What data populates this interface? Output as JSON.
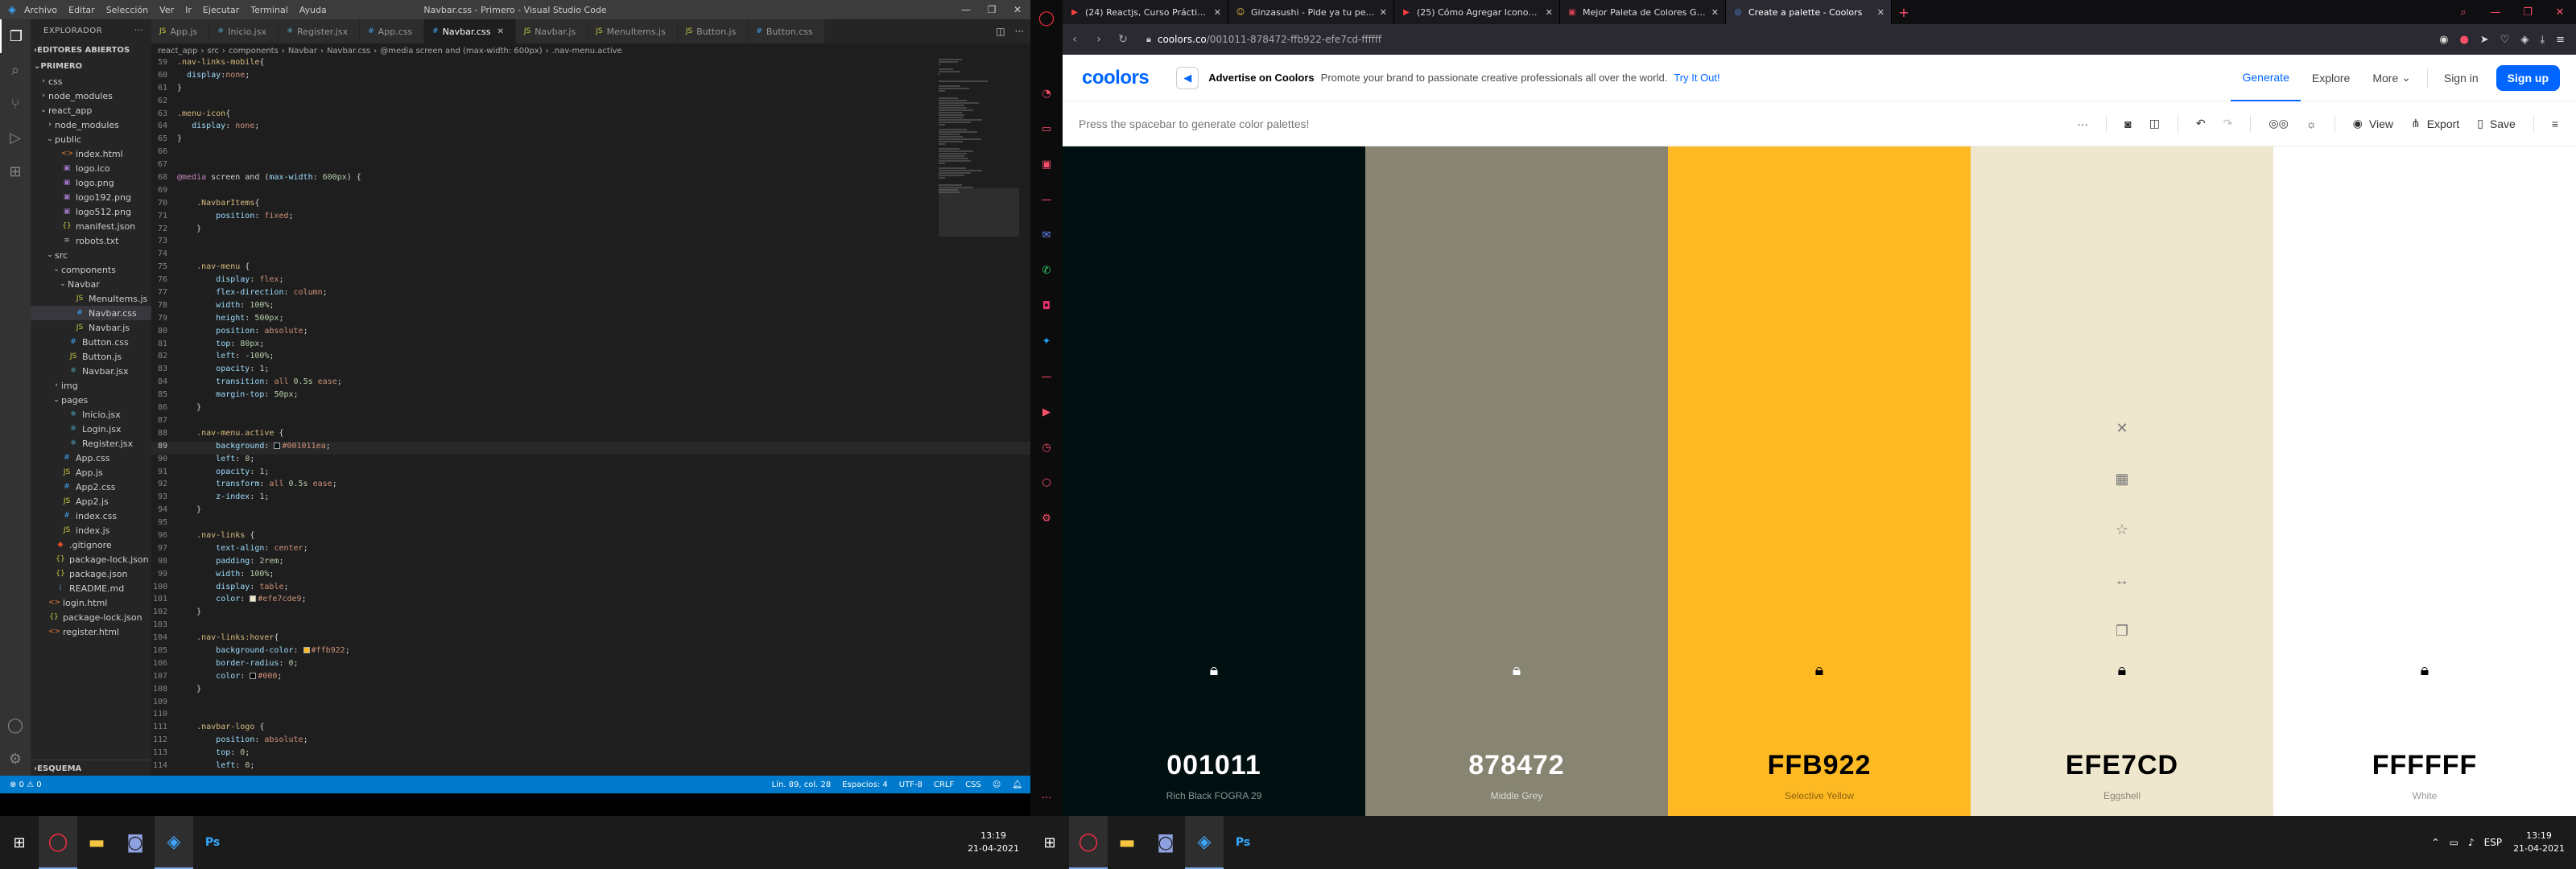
{
  "vscode": {
    "window_title": "Navbar.css - Primero - Visual Studio Code",
    "menu": [
      "Archivo",
      "Editar",
      "Selección",
      "Ver",
      "Ir",
      "Ejecutar",
      "Terminal",
      "Ayuda"
    ],
    "sidebar": {
      "header": "EXPLORADOR",
      "open_editors": "EDITORES ABIERTOS",
      "project": "PRIMERO",
      "outline": "ESQUEMA",
      "tree": [
        {
          "label": "css",
          "type": "folder",
          "depth": 1,
          "open": false
        },
        {
          "label": "node_modules",
          "type": "folder",
          "depth": 1,
          "open": false
        },
        {
          "label": "react_app",
          "type": "folder",
          "depth": 1,
          "open": true
        },
        {
          "label": "node_modules",
          "type": "folder",
          "depth": 2,
          "open": false
        },
        {
          "label": "public",
          "type": "folder",
          "depth": 2,
          "open": true
        },
        {
          "label": "index.html",
          "type": "html",
          "depth": 3
        },
        {
          "label": "logo.ico",
          "type": "img",
          "depth": 3
        },
        {
          "label": "logo.png",
          "type": "img",
          "depth": 3
        },
        {
          "label": "logo192.png",
          "type": "img",
          "depth": 3
        },
        {
          "label": "logo512.png",
          "type": "img",
          "depth": 3
        },
        {
          "label": "manifest.json",
          "type": "json",
          "depth": 3
        },
        {
          "label": "robots.txt",
          "type": "txt",
          "depth": 3
        },
        {
          "label": "src",
          "type": "folder",
          "depth": 2,
          "open": true
        },
        {
          "label": "components",
          "type": "folder",
          "depth": 3,
          "open": true
        },
        {
          "label": "Navbar",
          "type": "folder",
          "depth": 4,
          "open": true
        },
        {
          "label": "MenuItems.js",
          "type": "js",
          "depth": 5
        },
        {
          "label": "Navbar.css",
          "type": "css",
          "depth": 5,
          "selected": true
        },
        {
          "label": "Navbar.js",
          "type": "js",
          "depth": 5
        },
        {
          "label": "Button.css",
          "type": "css",
          "depth": 4
        },
        {
          "label": "Button.js",
          "type": "js",
          "depth": 4
        },
        {
          "label": "Navbar.jsx",
          "type": "jsx",
          "depth": 4
        },
        {
          "label": "img",
          "type": "folder",
          "depth": 3,
          "open": false
        },
        {
          "label": "pages",
          "type": "folder",
          "depth": 3,
          "open": true
        },
        {
          "label": "Inicio.jsx",
          "type": "jsx",
          "depth": 4
        },
        {
          "label": "Login.jsx",
          "type": "jsx",
          "depth": 4
        },
        {
          "label": "Register.jsx",
          "type": "jsx",
          "depth": 4
        },
        {
          "label": "App.css",
          "type": "css",
          "depth": 3
        },
        {
          "label": "App.js",
          "type": "js",
          "depth": 3
        },
        {
          "label": "App2.css",
          "type": "css",
          "depth": 3
        },
        {
          "label": "App2.js",
          "type": "js",
          "depth": 3
        },
        {
          "label": "index.css",
          "type": "css",
          "depth": 3
        },
        {
          "label": "index.js",
          "type": "js",
          "depth": 3
        },
        {
          "label": ".gitignore",
          "type": "git",
          "depth": 2
        },
        {
          "label": "package-lock.json",
          "type": "json",
          "depth": 2
        },
        {
          "label": "package.json",
          "type": "json",
          "depth": 2
        },
        {
          "label": "README.md",
          "type": "md",
          "depth": 2
        },
        {
          "label": "login.html",
          "type": "html",
          "depth": 1
        },
        {
          "label": "package-lock.json",
          "type": "json",
          "depth": 1
        },
        {
          "label": "register.html",
          "type": "html",
          "depth": 1
        }
      ]
    },
    "tabs": [
      {
        "label": "App.js",
        "type": "js"
      },
      {
        "label": "Inicio.jsx",
        "type": "jsx"
      },
      {
        "label": "Register.jsx",
        "type": "jsx"
      },
      {
        "label": "App.css",
        "type": "css"
      },
      {
        "label": "Navbar.css",
        "type": "css",
        "active": true
      },
      {
        "label": "Navbar.js",
        "type": "js"
      },
      {
        "label": "MenuItems.js",
        "type": "js"
      },
      {
        "label": "Button.js",
        "type": "js"
      },
      {
        "label": "Button.css",
        "type": "css"
      }
    ],
    "breadcrumb": [
      "react_app",
      "src",
      "components",
      "Navbar",
      "Navbar.css",
      "@media screen and (max-width: 600px)",
      ".nav-menu.active"
    ],
    "current_line": 89,
    "code": [
      {
        "n": 59,
        "html": "<span class='sel'>.nav-links-mobile</span>{"
      },
      {
        "n": 60,
        "html": "  <span class='prop'>display</span>:<span class='val'>none</span>;"
      },
      {
        "n": 61,
        "html": "}"
      },
      {
        "n": 62,
        "html": ""
      },
      {
        "n": 63,
        "html": "<span class='sel'>.menu-icon</span>{"
      },
      {
        "n": 64,
        "html": "   <span class='prop'>display</span>: <span class='val'>none</span>;"
      },
      {
        "n": 65,
        "html": "}"
      },
      {
        "n": 66,
        "html": ""
      },
      {
        "n": 67,
        "html": ""
      },
      {
        "n": 68,
        "html": "<span class='at'>@media</span> screen and (<span class='prop'>max-width</span>: <span class='num'>600px</span>) {"
      },
      {
        "n": 69,
        "html": ""
      },
      {
        "n": 70,
        "html": "    <span class='sel'>.NavbarItems</span>{"
      },
      {
        "n": 71,
        "html": "        <span class='prop'>position</span>: <span class='val'>fixed</span>;"
      },
      {
        "n": 72,
        "html": "    }"
      },
      {
        "n": 73,
        "html": ""
      },
      {
        "n": 74,
        "html": ""
      },
      {
        "n": 75,
        "html": "    <span class='sel'>.nav-menu</span> {"
      },
      {
        "n": 76,
        "html": "        <span class='prop'>display</span>: <span class='val'>flex</span>;"
      },
      {
        "n": 77,
        "html": "        <span class='prop'>flex-direction</span>: <span class='val'>column</span>;"
      },
      {
        "n": 78,
        "html": "        <span class='prop'>width</span>: <span class='num'>100%</span>;"
      },
      {
        "n": 79,
        "html": "        <span class='prop'>height</span>: <span class='num'>500px</span>;"
      },
      {
        "n": 80,
        "html": "        <span class='prop'>position</span>: <span class='val'>absolute</span>;"
      },
      {
        "n": 81,
        "html": "        <span class='prop'>top</span>: <span class='num'>80px</span>;"
      },
      {
        "n": 82,
        "html": "        <span class='prop'>left</span>: <span class='num'>-100%</span>;"
      },
      {
        "n": 83,
        "html": "        <span class='prop'>opacity</span>: <span class='num'>1</span>;"
      },
      {
        "n": 84,
        "html": "        <span class='prop'>transition</span>: <span class='val'>all</span> <span class='num'>0.5s</span> <span class='val'>ease</span>;"
      },
      {
        "n": 85,
        "html": "        <span class='prop'>margin-top</span>: <span class='num'>50px</span>;"
      },
      {
        "n": 86,
        "html": "    }"
      },
      {
        "n": 87,
        "html": ""
      },
      {
        "n": 88,
        "html": "    <span class='sel'>.nav-menu.active</span> {"
      },
      {
        "n": 89,
        "html": "        <span class='prop'>background</span>: <span class='sw' style='background:#001011'></span><span class='val'>#001011ea</span>;"
      },
      {
        "n": 90,
        "html": "        <span class='prop'>left</span>: <span class='num'>0</span>;"
      },
      {
        "n": 91,
        "html": "        <span class='prop'>opacity</span>: <span class='num'>1</span>;"
      },
      {
        "n": 92,
        "html": "        <span class='prop'>transform</span>: <span class='val'>all</span> <span class='num'>0.5s</span> <span class='val'>ease</span>;"
      },
      {
        "n": 93,
        "html": "        <span class='prop'>z-index</span>: <span class='num'>1</span>;"
      },
      {
        "n": 94,
        "html": "    }"
      },
      {
        "n": 95,
        "html": ""
      },
      {
        "n": 96,
        "html": "    <span class='sel'>.nav-links</span> {"
      },
      {
        "n": 97,
        "html": "        <span class='prop'>text-align</span>: <span class='val'>center</span>;"
      },
      {
        "n": 98,
        "html": "        <span class='prop'>padding</span>: <span class='num'>2rem</span>;"
      },
      {
        "n": 99,
        "html": "        <span class='prop'>width</span>: <span class='num'>100%</span>;"
      },
      {
        "n": 100,
        "html": "        <span class='prop'>display</span>: <span class='val'>table</span>;"
      },
      {
        "n": 101,
        "html": "        <span class='prop'>color</span>: <span class='sw' style='background:#efe7cd'></span><span class='val'>#efe7cde9</span>;"
      },
      {
        "n": 102,
        "html": "    }"
      },
      {
        "n": 103,
        "html": ""
      },
      {
        "n": 104,
        "html": "    <span class='sel'>.nav-links:hover</span>{"
      },
      {
        "n": 105,
        "html": "        <span class='prop'>background-color</span>: <span class='sw' style='background:#ffb922'></span><span class='val'>#ffb922</span>;"
      },
      {
        "n": 106,
        "html": "        <span class='prop'>border-radius</span>: <span class='num'>0</span>;"
      },
      {
        "n": 107,
        "html": "        <span class='prop'>color</span>: <span class='sw' style='background:#000'></span><span class='val'>#000</span>;"
      },
      {
        "n": 108,
        "html": "    }"
      },
      {
        "n": 109,
        "html": ""
      },
      {
        "n": 110,
        "html": ""
      },
      {
        "n": 111,
        "html": "    <span class='sel'>.navbar-logo</span> {"
      },
      {
        "n": 112,
        "html": "        <span class='prop'>position</span>: <span class='val'>absolute</span>;"
      },
      {
        "n": 113,
        "html": "        <span class='prop'>top</span>: <span class='num'>0</span>;"
      },
      {
        "n": 114,
        "html": "        <span class='prop'>left</span>: <span class='num'>0</span>;"
      }
    ],
    "status": {
      "errors": "⊗ 0 ⚠ 0",
      "position": "Lín. 89, col. 28",
      "spaces": "Espacios: 4",
      "encoding": "UTF-8",
      "eol": "CRLF",
      "language": "CSS"
    }
  },
  "browser": {
    "tabs": [
      {
        "label": "(24) Reactjs, Curso Práctico...",
        "fav": "▶",
        "color": "#ff4040"
      },
      {
        "label": "Ginzasushi - Pide ya tu pedi...",
        "fav": "☺",
        "color": "#f5c542"
      },
      {
        "label": "(25) Cómo Agregar Iconos...",
        "fav": "▶",
        "color": "#ff4040"
      },
      {
        "label": "Mejor Paleta de Colores Gr...",
        "fav": "▣",
        "color": "#e04050"
      },
      {
        "label": "Create a palette - Coolors",
        "fav": "◎",
        "color": "#4f9bff",
        "active": true
      }
    ],
    "url_host": "coolors.co",
    "url_path": "/001011-878472-ffb922-efe7cd-ffffff",
    "header": {
      "logo": "coolors",
      "ad_title": "Advertise on Coolors",
      "ad_text": "Promote your brand to passionate creative professionals all over the world.",
      "ad_link": "Try It Out!",
      "nav": [
        "Generate",
        "Explore",
        "More"
      ],
      "signin": "Sign in",
      "signup": "Sign up"
    },
    "toolbar": {
      "hint": "Press the spacebar to generate color palettes!",
      "view": "View",
      "export": "Export",
      "save": "Save"
    },
    "palette": [
      {
        "hex": "001011",
        "name": "Rich Black FOGRA 29",
        "color": "#001011",
        "text_color": "#ffffff",
        "name_color": "#8a9496"
      },
      {
        "hex": "878472",
        "name": "Middle Grey",
        "color": "#878472",
        "text_color": "#ffffff",
        "name_color": "#dcdbd3"
      },
      {
        "hex": "FFB922",
        "name": "Selective Yellow",
        "color": "#ffb922",
        "text_color": "#000000",
        "name_color": "#8a6412"
      },
      {
        "hex": "EFE7CD",
        "name": "Eggshell",
        "color": "#efe7cd",
        "text_color": "#000000",
        "name_color": "#8a8677"
      },
      {
        "hex": "FFFFFF",
        "name": "White",
        "color": "#ffffff",
        "text_color": "#000000",
        "name_color": "#999999"
      }
    ]
  },
  "taskbar": {
    "time": "13:19",
    "date": "21-04-2021",
    "lang": "ESP"
  }
}
